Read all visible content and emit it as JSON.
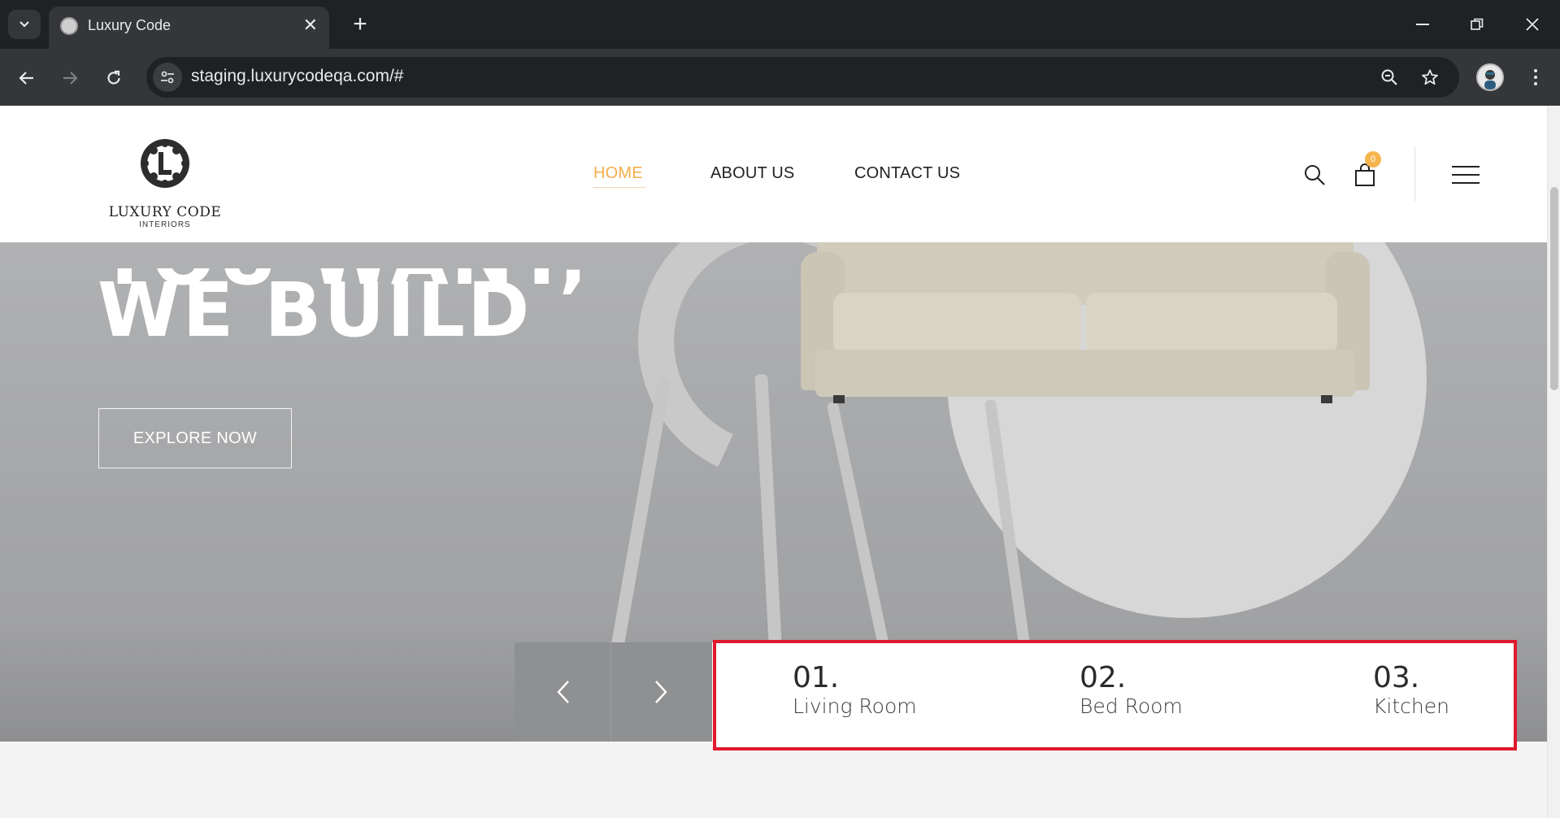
{
  "browser": {
    "tab_title": "Luxury Code",
    "url": "staging.luxurycodeqa.com/#"
  },
  "site": {
    "logo_text": "LUXURY CODE",
    "logo_subtext": "INTERIORS",
    "nav": [
      {
        "label": "HOME",
        "active": true
      },
      {
        "label": "ABOUT US",
        "active": false
      },
      {
        "label": "CONTACT US",
        "active": false
      }
    ],
    "cart_count": "0"
  },
  "hero": {
    "title_line1": "YOU WANT,",
    "title_line2": "WE BUILD",
    "cta_label": "EXPLORE NOW"
  },
  "rooms": [
    {
      "number": "01.",
      "name": "Living Room"
    },
    {
      "number": "02.",
      "name": "Bed Room"
    },
    {
      "number": "03.",
      "name": "Kitchen"
    }
  ],
  "colors": {
    "accent": "#f4ae4b",
    "highlight_border": "#e0192d"
  },
  "icons": [
    "tab-search-icon",
    "close-icon",
    "plus-icon",
    "minimize-icon",
    "restore-icon",
    "back-icon",
    "forward-icon",
    "reload-icon",
    "site-info-icon",
    "zoom-icon",
    "star-icon",
    "search-icon",
    "cart-icon",
    "menu-icon",
    "chevron-left-icon",
    "chevron-right-icon"
  ]
}
